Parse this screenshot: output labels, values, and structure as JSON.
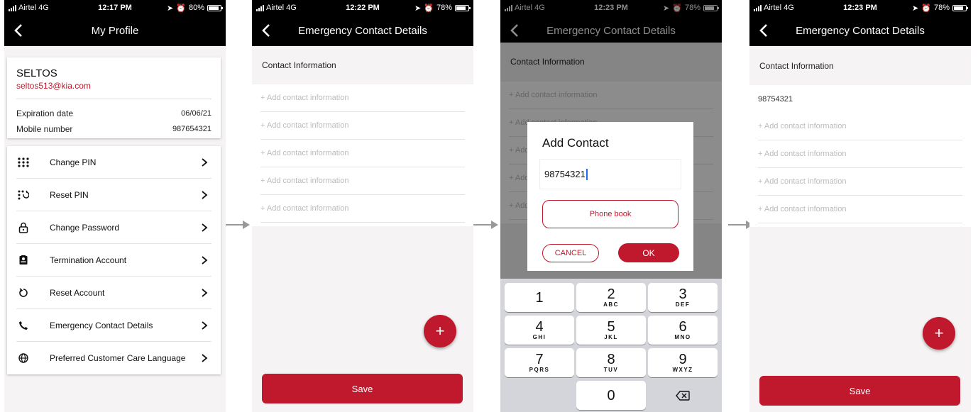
{
  "status_bars": [
    {
      "carrier": "Airtel  4G",
      "time": "12:17 PM",
      "battery": "80%"
    },
    {
      "carrier": "Airtel  4G",
      "time": "12:22 PM",
      "battery": "78%"
    },
    {
      "carrier": "Airtel  4G",
      "time": "12:23 PM",
      "battery": "78%"
    },
    {
      "carrier": "Airtel  4G",
      "time": "12:23 PM",
      "battery": "78%"
    }
  ],
  "profile": {
    "title": "My Profile",
    "name": "SELTOS",
    "email": "seltos513@kia.com",
    "expiration_label": "Expiration date",
    "expiration_value": "06/06/21",
    "mobile_label": "Mobile number",
    "mobile_value": "987654321",
    "menu": [
      {
        "label": "Change PIN",
        "icon": "keypad-icon"
      },
      {
        "label": "Reset PIN",
        "icon": "reset-pin-icon"
      },
      {
        "label": "Change Password",
        "icon": "lock-icon"
      },
      {
        "label": "Termination Account",
        "icon": "id-card-icon"
      },
      {
        "label": "Reset Account",
        "icon": "reset-icon"
      },
      {
        "label": "Emergency Contact Details",
        "icon": "phone-icon"
      },
      {
        "label": "Preferred Customer Care Language",
        "icon": "globe-icon"
      }
    ]
  },
  "emergency": {
    "title": "Emergency Contact Details",
    "section": "Contact Information",
    "placeholder": "+ Add contact information",
    "fab": "+",
    "save": "Save",
    "filled_value": "98754321"
  },
  "dialog": {
    "title": "Add Contact",
    "input_value": "98754321",
    "phonebook": "Phone book",
    "cancel": "CANCEL",
    "ok": "OK"
  },
  "keypad": {
    "keys": [
      {
        "digit": "1",
        "letters": ""
      },
      {
        "digit": "2",
        "letters": "ABC"
      },
      {
        "digit": "3",
        "letters": "DEF"
      },
      {
        "digit": "4",
        "letters": "GHI"
      },
      {
        "digit": "5",
        "letters": "JKL"
      },
      {
        "digit": "6",
        "letters": "MNO"
      },
      {
        "digit": "7",
        "letters": "PQRS"
      },
      {
        "digit": "8",
        "letters": "TUV"
      },
      {
        "digit": "9",
        "letters": "WXYZ"
      },
      {
        "digit": "0",
        "letters": ""
      }
    ]
  },
  "colors": {
    "accent": "#c0182c",
    "bar": "#000000",
    "background": "#f5f3f3"
  }
}
